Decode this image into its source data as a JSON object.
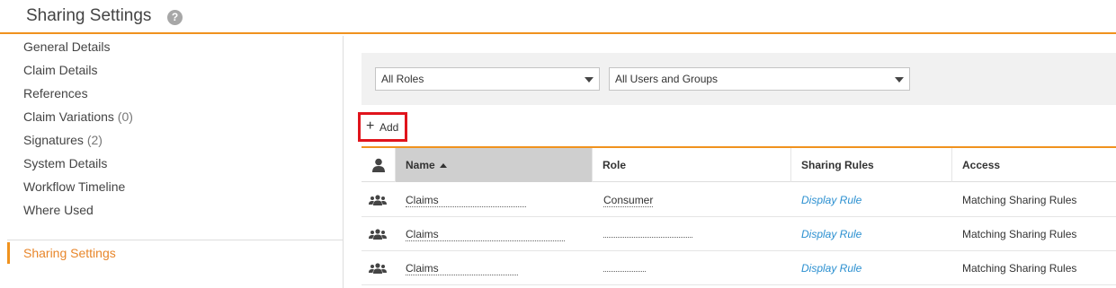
{
  "header": {
    "title": "Sharing Settings",
    "help_icon": "?"
  },
  "sidebar": {
    "items": [
      {
        "label": "General Details",
        "count": ""
      },
      {
        "label": "Claim Details",
        "count": ""
      },
      {
        "label": "References",
        "count": ""
      },
      {
        "label": "Claim Variations",
        "count": "(0)"
      },
      {
        "label": "Signatures",
        "count": "(2)"
      },
      {
        "label": "System Details",
        "count": ""
      },
      {
        "label": "Workflow Timeline",
        "count": ""
      },
      {
        "label": "Where Used",
        "count": ""
      }
    ],
    "active": "Sharing Settings"
  },
  "filters": {
    "roles": "All Roles",
    "users": "All Users and Groups"
  },
  "toolbar": {
    "add_label": "Add",
    "add_icon": "+"
  },
  "table": {
    "columns": {
      "name": "Name",
      "role": "Role",
      "rules": "Sharing Rules",
      "access": "Access"
    },
    "rows": [
      {
        "name": "Claims",
        "role": "Consumer",
        "rules": "Display Rule",
        "access": "Matching Sharing Rules"
      },
      {
        "name": "Claims",
        "role": "",
        "rules": "Display Rule",
        "access": "Matching Sharing Rules"
      },
      {
        "name": "Claims",
        "role": "",
        "rules": "Display Rule",
        "access": "Matching Sharing Rules"
      }
    ]
  },
  "colors": {
    "accent": "#f0921e",
    "link": "#2a8fd0",
    "highlight": "#e0141c"
  }
}
